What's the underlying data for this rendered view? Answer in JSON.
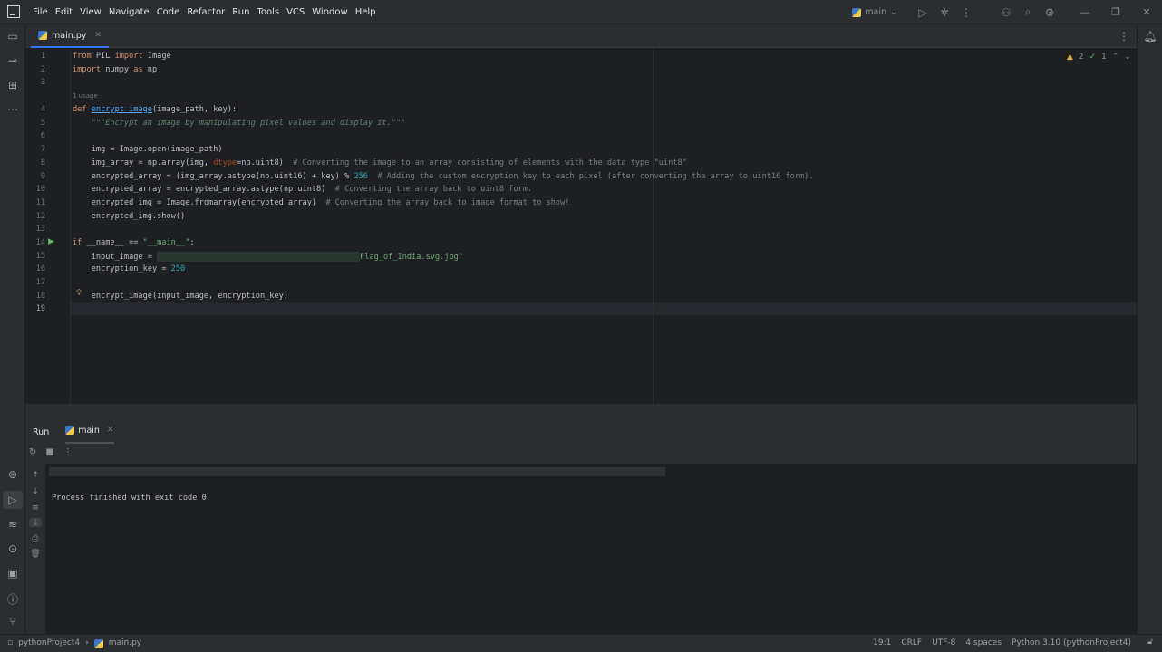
{
  "menu": [
    "File",
    "Edit",
    "View",
    "Navigate",
    "Code",
    "Refactor",
    "Run",
    "Tools",
    "VCS",
    "Window",
    "Help"
  ],
  "branch": "main",
  "tab": {
    "label": "main.py"
  },
  "inspections": {
    "warnings": "2",
    "weak": "1"
  },
  "editor": {
    "line_numbers": [
      "1",
      "2",
      "3",
      "4",
      "5",
      "6",
      "7",
      "8",
      "9",
      "10",
      "11",
      "12",
      "13",
      "14",
      "15",
      "16",
      "17",
      "18",
      "19"
    ],
    "usage_hint": "1 usage",
    "l1a": "from",
    "l1b": " PIL ",
    "l1c": "import",
    "l1d": " Image",
    "l2a": "import",
    "l2b": " numpy ",
    "l2c": "as",
    "l2d": " np",
    "l4a": "def",
    "l4b": "encrypt_image",
    "l4c": "(image_path, key):",
    "l5": "\"\"\"Encrypt an image by manipulating pixel values and display it.\"\"\"",
    "l7": "    img = Image.open(image_path)",
    "l8a": "    img_array = np.array(img, ",
    "l8b": "dtype",
    "l8c": "=np.uint8)  ",
    "l8d": "# Converting the image to an array consisting of elements with the data type \"uint8\"",
    "l9a": "    encrypted_array = (img_array.astype(np.uint16) + key) % ",
    "l9b": "256",
    "l9c": "  # Adding the custom encryption key to each pixel (after converting the array to uint16 form).",
    "l10a": "    encrypted_array = encrypted_array.astype(np.uint8)  ",
    "l10b": "# Converting the array back to uint8 form.",
    "l11a": "    encrypted_img = Image.fromarray(encrypted_array)  ",
    "l11b": "# Converting the array back to image format to show!",
    "l12": "    encrypted_img.show()",
    "l14a": "if",
    "l14b": " __name__ == ",
    "l14c": "\"__main__\"",
    "l14d": ":",
    "l15a": "    input_image = ",
    "l15b": "Flag_of_India.svg.jpg\"",
    "l16a": "    encryption_key = ",
    "l16b": "250",
    "l18": "    encrypt_image(input_image, encryption_key)"
  },
  "run_panel": {
    "title": "Run",
    "tab": "main",
    "output": "Process finished with exit code 0"
  },
  "status": {
    "project": "pythonProject4",
    "file": "main.py",
    "position": "19:1",
    "line_sep": "CRLF",
    "encoding": "UTF-8",
    "indent": "4 spaces",
    "interpreter": "Python 3.10 (pythonProject4)"
  }
}
